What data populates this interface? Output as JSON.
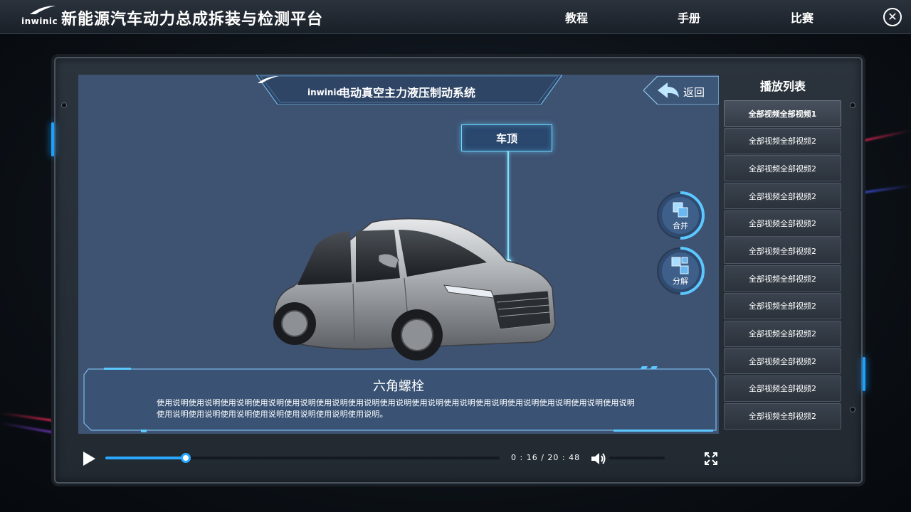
{
  "header": {
    "logo_text": "inwinic",
    "title": "新能源汽车动力总成拆装与检测平台",
    "tabs": [
      {
        "label": "教程"
      },
      {
        "label": "手册"
      },
      {
        "label": "比赛"
      }
    ],
    "close_icon": "close-icon"
  },
  "viewer": {
    "banner_logo_text": "inwinic",
    "title": "电动真空主力液压制动系统",
    "back_label": "返回",
    "part_label": "车顶",
    "merge_label": "合并",
    "explode_label": "分解",
    "info_title": "六角螺栓",
    "info_desc": "使用说明使用说明使用说明使用说明使用说明使用说明使用说明使用说明使用说明使用说明使用说明使用说明使用说明使用说明使用说明使用说明使用说明使用说明使用说明使用说明使用说明使用说明。"
  },
  "playlist": {
    "title": "播放列表",
    "items": [
      {
        "label": "全部视频全部视频1",
        "active": true
      },
      {
        "label": "全部视频全部视频2",
        "active": false
      },
      {
        "label": "全部视频全部视频2",
        "active": false
      },
      {
        "label": "全部视频全部视频2",
        "active": false
      },
      {
        "label": "全部视频全部视频2",
        "active": false
      },
      {
        "label": "全部视频全部视频2",
        "active": false
      },
      {
        "label": "全部视频全部视频2",
        "active": false
      },
      {
        "label": "全部视频全部视频2",
        "active": false
      },
      {
        "label": "全部视频全部视频2",
        "active": false
      },
      {
        "label": "全部视频全部视频2",
        "active": false
      },
      {
        "label": "全部视频全部视频2",
        "active": false
      },
      {
        "label": "全部视频全部视频2",
        "active": false
      }
    ]
  },
  "player": {
    "time_text": "0 : 16  /  20 : 48",
    "progress_fraction": 0.2045,
    "volume_fraction": 0.0,
    "accent_color": "#2aa8ff"
  }
}
